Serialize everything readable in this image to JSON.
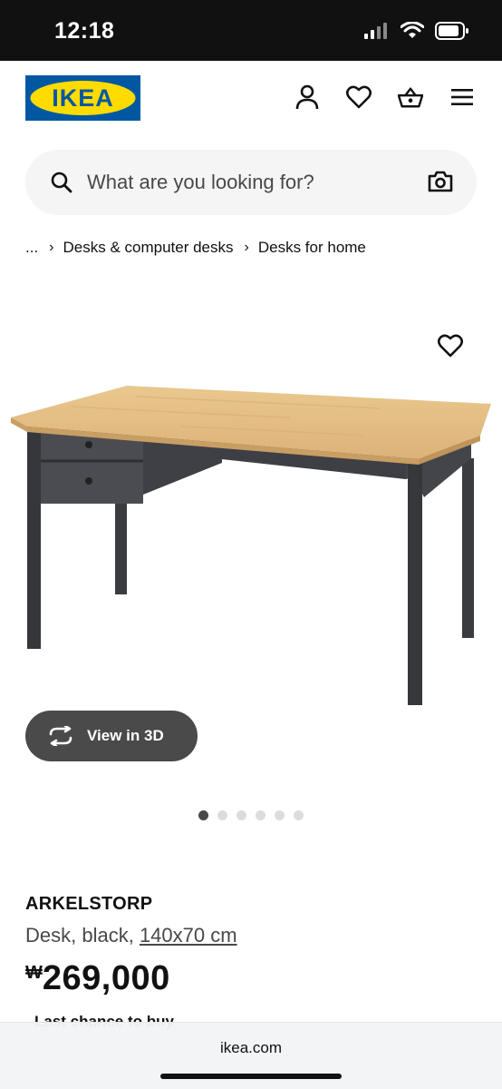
{
  "status_bar": {
    "time": "12:18"
  },
  "header": {
    "logo_text": "IKEA",
    "icons": [
      "account-icon",
      "heart-icon",
      "basket-icon",
      "menu-icon"
    ]
  },
  "search": {
    "placeholder": "What are you looking for?"
  },
  "breadcrumb": {
    "ellipsis": "...",
    "items": [
      "Desks & computer desks",
      "Desks for home"
    ]
  },
  "product": {
    "view3d_label": "View in 3D",
    "name": "ARKELSTORP",
    "description": "Desk, black, ",
    "size": "140x70 cm",
    "currency": "₩",
    "price": "269,000",
    "last_chance": "Last chance to buy",
    "image_count": 6,
    "active_image": 0
  },
  "browser": {
    "url": "ikea.com"
  },
  "colors": {
    "brand_blue": "#0058a3",
    "brand_yellow": "#ffdb00",
    "dark_button": "#4a4a4a"
  }
}
